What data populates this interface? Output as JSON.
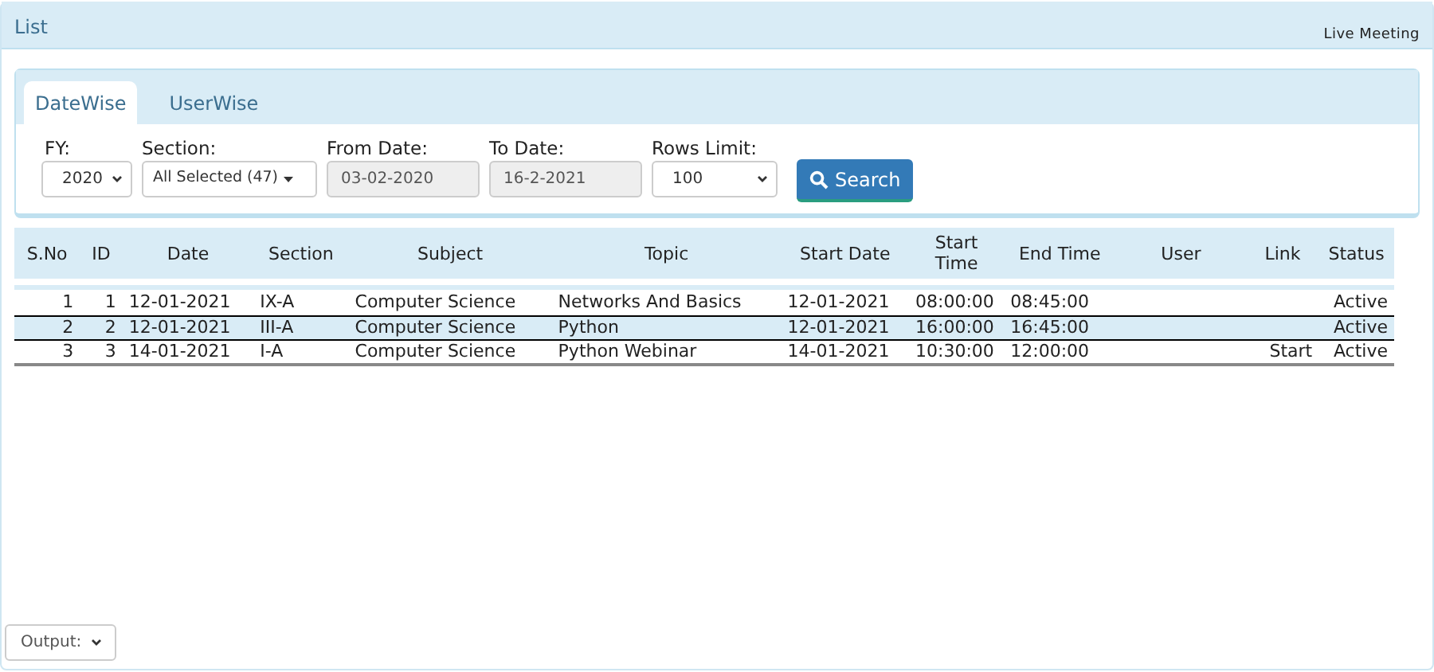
{
  "header": {
    "title": "List",
    "link": "Live Meeting"
  },
  "tabs": [
    {
      "label": "DateWise",
      "selected": true
    },
    {
      "label": "UserWise",
      "selected": false
    }
  ],
  "filters": [
    {
      "kind": "select",
      "label": "FY:",
      "value": "2020"
    },
    {
      "kind": "multiselect",
      "label": "Section:",
      "value": "All Selected (47)"
    },
    {
      "kind": "date",
      "label": "From Date:",
      "value": "03-02-2020"
    },
    {
      "kind": "date",
      "label": "To Date:",
      "value": "16-2-2021"
    },
    {
      "kind": "select",
      "label": "Rows Limit:",
      "value": "100"
    }
  ],
  "search_button": {
    "label": "Search"
  },
  "table": {
    "columns": [
      "S.No",
      "ID",
      "Date",
      "Section",
      "Subject",
      "Topic",
      "Start Date",
      "Start Time",
      "End Time",
      "User",
      "Link",
      "Status"
    ],
    "rows": [
      [
        "1",
        "1",
        "12-01-2021",
        "IX-A",
        "Computer Science",
        "Networks And Basics",
        "12-01-2021",
        "08:00:00",
        "08:45:00",
        "",
        "",
        "Active"
      ],
      [
        "2",
        "2",
        "12-01-2021",
        "III-A",
        "Computer Science",
        "Python",
        "12-01-2021",
        "16:00:00",
        "16:45:00",
        "",
        "",
        "Active"
      ],
      [
        "3",
        "3",
        "14-01-2021",
        "I-A",
        "Computer Science",
        "Python Webinar",
        "14-01-2021",
        "10:30:00",
        "12:00:00",
        "",
        "Start",
        "Active"
      ]
    ]
  },
  "output_select": {
    "value": "Output:"
  }
}
